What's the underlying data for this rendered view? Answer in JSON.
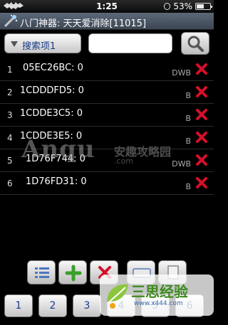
{
  "status_bar": {
    "time": "1:25",
    "battery": "53%",
    "battery_level": 0.53
  },
  "title_bar": {
    "title": "八门神器: 天天爱消除[11015]"
  },
  "search": {
    "dropdown_label": "搜索项1",
    "input_value": ""
  },
  "results": [
    {
      "index": "1",
      "address": "05EC26BC: 0",
      "type": "DWB"
    },
    {
      "index": "2",
      "address": "1CDDDFD5: 0",
      "type": "B"
    },
    {
      "index": "3",
      "address": "1CDDE3C5: 0",
      "type": "B"
    },
    {
      "index": "4",
      "address": "1CDDE3E5: 0",
      "type": "B"
    },
    {
      "index": "5",
      "address": "1D76F744: 0",
      "type": "DWB"
    },
    {
      "index": "6",
      "address": "1D76FD31: 0",
      "type": "B"
    }
  ],
  "keypad": {
    "keys": [
      "1",
      "2",
      "3",
      "4",
      "5",
      "6",
      "7"
    ]
  },
  "watermark_anqu": {
    "brand": "Anqu",
    "chinese": "安趣攻略园",
    "domain": ".com"
  },
  "watermark_sansi": {
    "name": "三思经验",
    "url": "www.x444.com"
  },
  "colors": {
    "delete_red": "#d4102a",
    "accent_blue": "#1a3c8a",
    "add_green": "#3aa02a"
  }
}
